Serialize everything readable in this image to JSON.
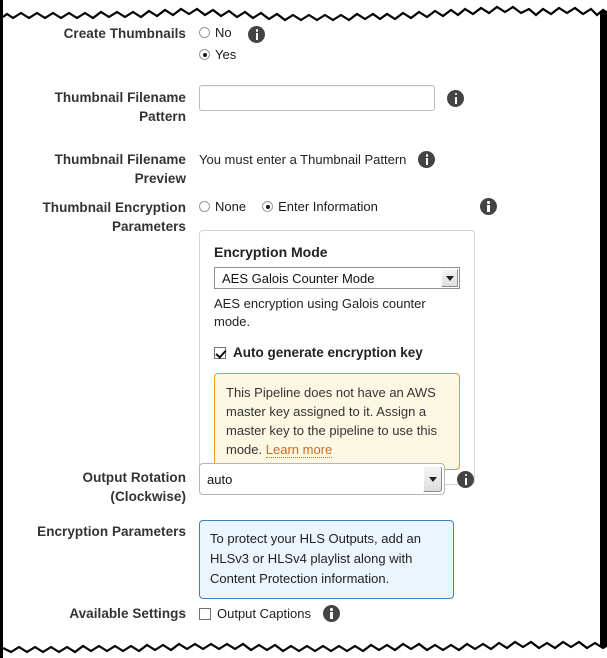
{
  "form": {
    "rows": [
      {
        "label": "Create Thumbnails",
        "type": "radio-vertical",
        "options": [
          {
            "label": "No",
            "selected": false
          },
          {
            "label": "Yes",
            "selected": true
          }
        ],
        "info_icon": "info-icon"
      },
      {
        "label": "Thumbnail Filename Pattern",
        "type": "text",
        "value": "",
        "placeholder": "",
        "info_icon": "info-icon"
      },
      {
        "label": "Thumbnail Filename Preview",
        "type": "static",
        "text": "You must enter a Thumbnail Pattern",
        "info_icon": "info-icon"
      },
      {
        "label": "Thumbnail Encryption Parameters",
        "type": "radio-horizontal",
        "options": [
          {
            "label": "None",
            "selected": false
          },
          {
            "label": "Enter Information",
            "selected": true
          }
        ],
        "info_icon": "info-icon"
      },
      {
        "label": "Output Rotation (Clockwise)",
        "type": "select",
        "value": "auto",
        "info_icon": "info-icon"
      },
      {
        "label": "Encryption Parameters",
        "type": "bluebox",
        "text": "To protect your HLS Outputs, add an HLSv3 or HLSv4 playlist along with Content Protection information."
      },
      {
        "label": "Available Settings",
        "type": "checkbox",
        "checkbox_label": "Output Captions",
        "checked": false,
        "info_icon": "info-icon"
      }
    ]
  },
  "encryption_panel": {
    "title": "Encryption Mode",
    "select_value": "AES Galois Counter Mode",
    "description": "AES encryption using Galois counter mode.",
    "auto_generate_label": "Auto generate encryption key",
    "auto_generate_checked": true,
    "warning_text": "This Pipeline does not have an AWS master key assigned to it. Assign a master key to the pipeline to use this mode. ",
    "warning_link": "Learn more"
  },
  "labels": {
    "create_thumbnails": "Create Thumbnails",
    "thumbnail_filename_pattern_l1": "Thumbnail Filename",
    "thumbnail_filename_pattern_l2": "Pattern",
    "thumbnail_filename_preview_l1": "Thumbnail Filename",
    "thumbnail_filename_preview_l2": "Preview",
    "thumbnail_encryption_l1": "Thumbnail Encryption",
    "thumbnail_encryption_l2": "Parameters",
    "output_rotation_l1": "Output Rotation",
    "output_rotation_l2": "(Clockwise)",
    "encryption_parameters": "Encryption Parameters",
    "available_settings": "Available Settings"
  },
  "colors": {
    "label": "#333333",
    "info_icon": "#444444",
    "warning_border": "#e8962f",
    "warning_bg": "#fdf8e3",
    "warning_link": "#d2691e",
    "blue_border": "#3b7fc4",
    "blue_bg": "#ecf4fd"
  }
}
